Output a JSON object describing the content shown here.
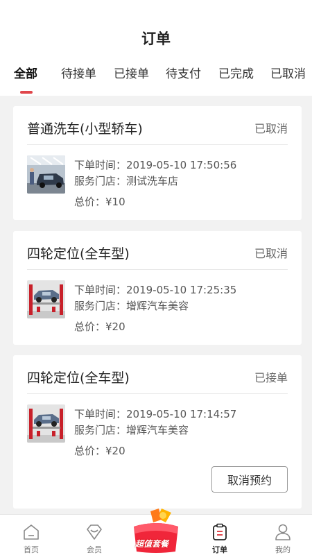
{
  "header": {
    "title": "订单",
    "tabs": [
      "全部",
      "待接单",
      "已接单",
      "待支付",
      "已完成",
      "已取消"
    ],
    "active_tab_index": 0,
    "accent_color": "#e0464b"
  },
  "orders": [
    {
      "title": "普通洗车(小型轿车)",
      "status": "已取消",
      "thumb_icon": "car-wash-photo",
      "time_line": "下单时间：2019-05-10 17:50:56",
      "store_line": "服务门店：测试洗车店",
      "price_line": "总价：¥10"
    },
    {
      "title": "四轮定位(全车型)",
      "status": "已取消",
      "thumb_icon": "car-lift-photo",
      "time_line": "下单时间：2019-05-10 17:25:35",
      "store_line": "服务门店：增辉汽车美容",
      "price_line": "总价：¥20"
    },
    {
      "title": "四轮定位(全车型)",
      "status": "已接单",
      "thumb_icon": "car-lift-photo",
      "time_line": "下单时间：2019-05-10 17:14:57",
      "store_line": "服务门店：增辉汽车美容",
      "price_line": "总价：¥20",
      "action_label": "取消预约"
    }
  ],
  "bottom_nav": {
    "items": [
      {
        "label": "首页",
        "icon": "home-icon"
      },
      {
        "label": "会员",
        "icon": "heart-icon"
      },
      {
        "label": "订单",
        "icon": "order-icon",
        "active": true
      },
      {
        "label": "我的",
        "icon": "user-icon"
      }
    ],
    "promo_label": "超值套餐"
  }
}
